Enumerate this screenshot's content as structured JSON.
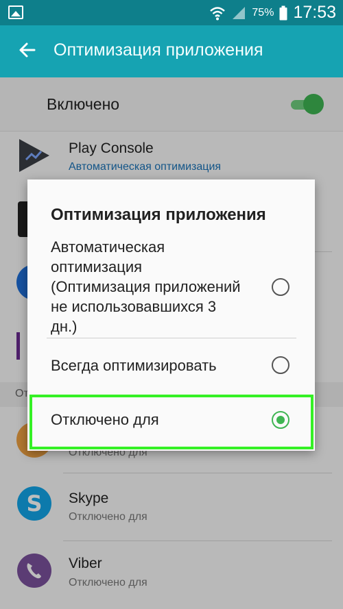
{
  "status_bar": {
    "battery": "75%",
    "time": "17:53"
  },
  "app_bar": {
    "title": "Оптимизация приложения"
  },
  "toggle": {
    "label": "Включено",
    "on": true
  },
  "apps": [
    {
      "name": "Play Console",
      "status": "Автоматическая оптимизация"
    },
    {
      "name": "Skype",
      "status": "Отключено для"
    },
    {
      "name": "Viber",
      "status": "Отключено для"
    }
  ],
  "partial_texts": {
    "section_prefix": "От",
    "g_status": "Отключено для"
  },
  "dialog": {
    "title": "Оптимизация приложения",
    "options": [
      {
        "label_lines": [
          "Автоматическая",
          "оптимизация",
          "(Оптимизация приложений",
          "не использовавшихся 3",
          "дн.)"
        ],
        "selected": false
      },
      {
        "label": "Всегда оптимизировать",
        "selected": false
      },
      {
        "label": "Отключено для",
        "selected": true
      }
    ]
  },
  "colors": {
    "status_bar": "#0e7f8b",
    "app_bar": "#16a3b2",
    "accent_green": "#3fb553",
    "highlight": "#35f025"
  }
}
